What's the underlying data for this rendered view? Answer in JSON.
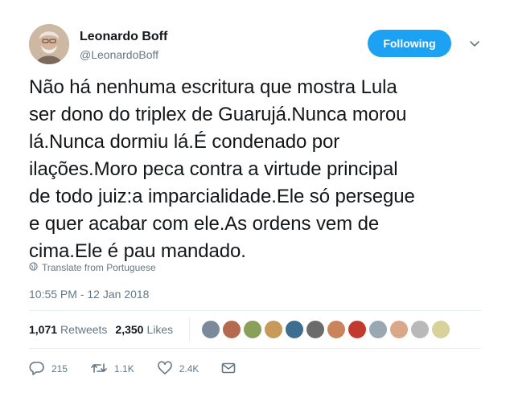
{
  "author": {
    "name": "Leonardo Boff",
    "handle": "@LeonardoBoff",
    "follow_label": "Following"
  },
  "tweet": {
    "text": "Não há nenhuma escritura que mostra Lula\nser dono do triplex de Guarujá.Nunca morou\nlá.Nunca dormiu lá.É condenado por\nilações.Moro peca contra a virtude principal\nde todo juiz:a imparcialidade.Ele só persegue\ne quer acabar com ele.As ordens vem de\ncima.Ele é pau mandado.",
    "translate_label": "Translate from Portuguese",
    "timestamp": "10:55 PM - 12 Jan 2018"
  },
  "stats": {
    "retweets_count": "1,071",
    "retweets_label": "Retweets",
    "likes_count": "2,350",
    "likes_label": "Likes"
  },
  "liker_avatars": [
    "#7a8a9a",
    "#b5694e",
    "#8aa05a",
    "#c69a5a",
    "#3d6e8f",
    "#6b6b6b",
    "#c9845c",
    "#c23a2e",
    "#9aa8b4",
    "#d9a88a",
    "#b9b9b9",
    "#d6d29a"
  ],
  "actions": {
    "replies": "215",
    "retweets": "1.1K",
    "likes": "2.4K"
  },
  "colors": {
    "accent": "#1da1f2",
    "secondary_text": "#657786"
  }
}
